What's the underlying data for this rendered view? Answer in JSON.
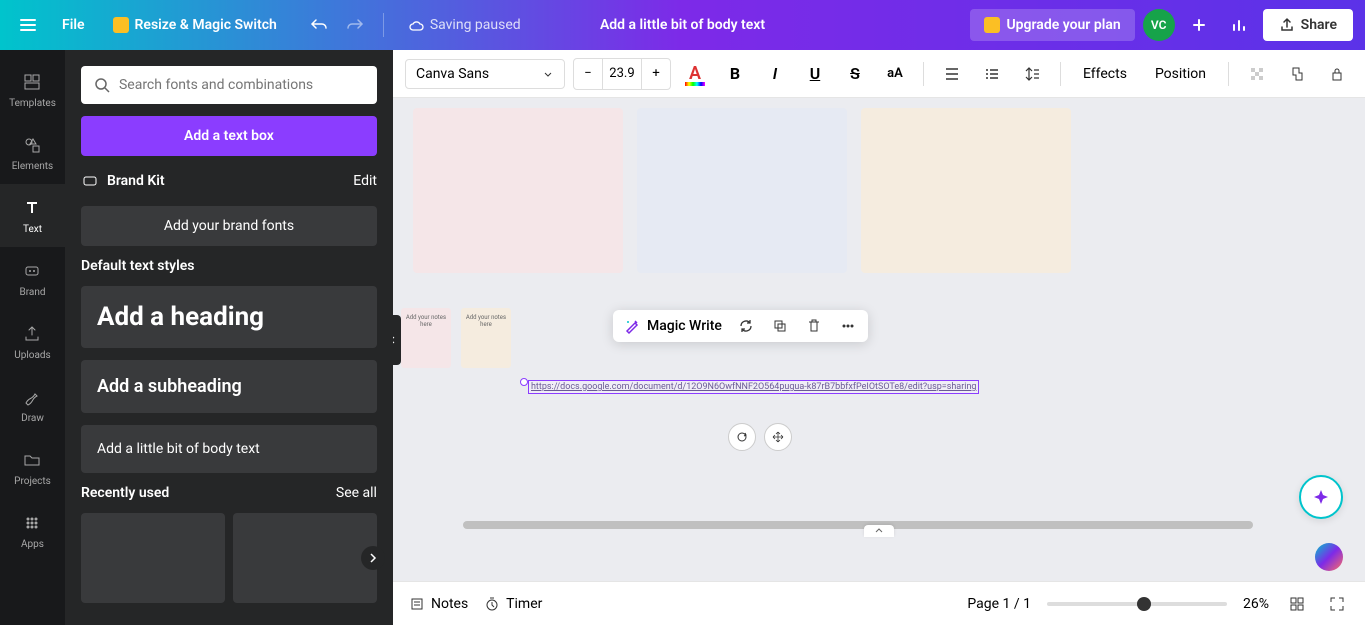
{
  "topbar": {
    "file": "File",
    "resize": "Resize & Magic Switch",
    "saving": "Saving paused",
    "title": "Add a little bit of body text",
    "upgrade": "Upgrade your plan",
    "avatar": "VC",
    "share": "Share"
  },
  "nav": {
    "templates": "Templates",
    "elements": "Elements",
    "text": "Text",
    "brand": "Brand",
    "uploads": "Uploads",
    "draw": "Draw",
    "projects": "Projects",
    "apps": "Apps"
  },
  "panel": {
    "search_placeholder": "Search fonts and combinations",
    "add_textbox": "Add a text box",
    "brand_kit": "Brand Kit",
    "edit": "Edit",
    "brand_fonts": "Add your brand fonts",
    "default_styles": "Default text styles",
    "heading": "Add a heading",
    "subheading": "Add a subheading",
    "body": "Add a little bit of body text",
    "recently": "Recently used",
    "see_all": "See all"
  },
  "toolbar": {
    "font": "Canva Sans",
    "font_size": "23.9",
    "effects": "Effects",
    "position": "Position"
  },
  "canvas": {
    "small_card_text": "Add your notes here",
    "link_text": "https://docs.google.com/document/d/12O9N6OwfNNF2O564pugua-k87rB7bbfxfPeIOtSOTe8/edit?usp=sharing",
    "magic_write": "Magic Write"
  },
  "bottom": {
    "notes": "Notes",
    "timer": "Timer",
    "page_info": "Page 1 / 1",
    "zoom": "26%"
  }
}
